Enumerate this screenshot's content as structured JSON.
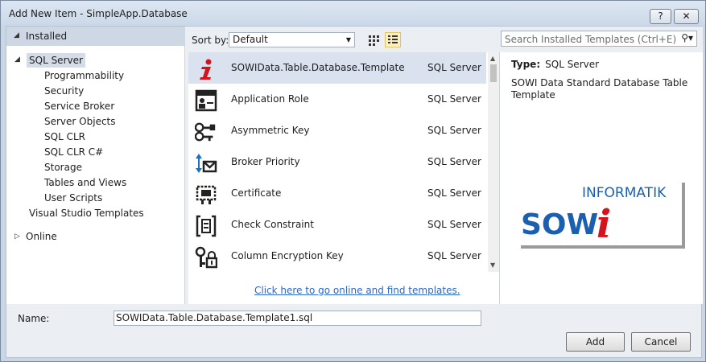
{
  "window": {
    "title": "Add New Item - SimpleApp.Database",
    "help_label": "?",
    "close_label": "✕"
  },
  "tree": {
    "installed_label": "Installed",
    "sql_server_label": "SQL Server",
    "children": [
      "Programmability",
      "Security",
      "Service Broker",
      "Server Objects",
      "SQL CLR",
      "SQL CLR C#",
      "Storage",
      "Tables and Views",
      "User Scripts"
    ],
    "visual_studio_templates_label": "Visual Studio Templates",
    "online_label": "Online"
  },
  "toolbar": {
    "sort_label": "Sort by:",
    "sort_value": "Default",
    "search_placeholder": "Search Installed Templates (Ctrl+E)"
  },
  "templates": [
    {
      "name": "SOWIData.Table.Database.Template",
      "category": "SQL Server",
      "icon": "sowi-info-icon",
      "selected": true
    },
    {
      "name": "Application Role",
      "category": "SQL Server",
      "icon": "application-role-icon"
    },
    {
      "name": "Asymmetric Key",
      "category": "SQL Server",
      "icon": "asymmetric-key-icon"
    },
    {
      "name": "Broker Priority",
      "category": "SQL Server",
      "icon": "broker-priority-icon"
    },
    {
      "name": "Certificate",
      "category": "SQL Server",
      "icon": "certificate-icon"
    },
    {
      "name": "Check Constraint",
      "category": "SQL Server",
      "icon": "check-constraint-icon"
    },
    {
      "name": "Column Encryption Key",
      "category": "SQL Server",
      "icon": "column-encryption-key-icon"
    }
  ],
  "online_link": "Click here to go online and find templates.",
  "details": {
    "type_label": "Type:",
    "type_value": "SQL Server",
    "description": "SOWI Data Standard Database Table Template",
    "logo_text_top": "INFORMATIK",
    "logo_text_sowi": "SOW",
    "logo_text_i": "i"
  },
  "footer": {
    "name_label": "Name:",
    "name_value": "SOWIData.Table.Database.Template1.sql",
    "add_label": "Add",
    "cancel_label": "Cancel"
  }
}
